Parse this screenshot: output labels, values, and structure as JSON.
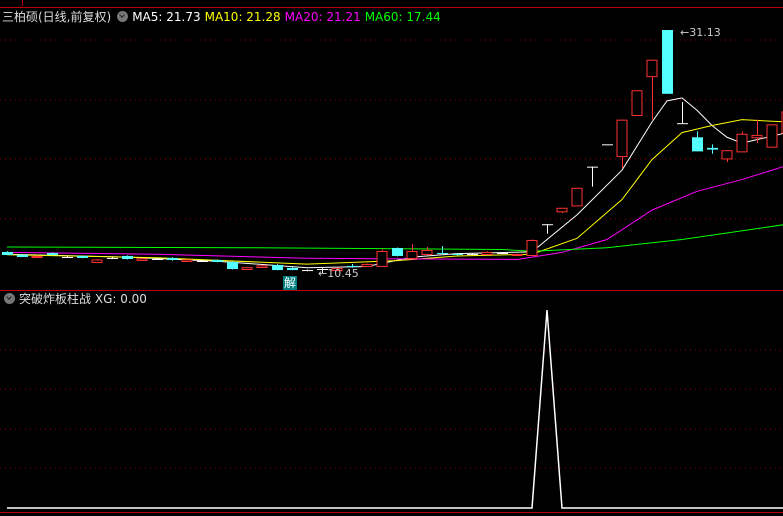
{
  "main": {
    "title": "三柏硕(日线,前复权)",
    "ma_labels": [
      {
        "label": "MA5: 21.73",
        "color": "#ffffff"
      },
      {
        "label": "MA10: 21.28",
        "color": "#ffff00"
      },
      {
        "label": "MA20: 21.21",
        "color": "#ff00ff"
      },
      {
        "label": "MA60: 17.44",
        "color": "#00ff00"
      }
    ],
    "high_label": "31.13",
    "low_label": "10.45",
    "marker_label": "解"
  },
  "sub": {
    "title": "突破炸板柱战",
    "xg_label": "XG: 0.00"
  },
  "colors": {
    "up": "#ff3232",
    "down": "#54ffff",
    "flat": "#ffffff",
    "grid": "#8b0000",
    "border": "#c00000"
  },
  "chart_data": [
    {
      "type": "candlestick",
      "ylim": [
        9.5,
        31.6
      ],
      "candles": [
        [
          12.24,
          12.3,
          12.0,
          11.98
        ],
        [
          12.0,
          12.05,
          11.8,
          11.81
        ],
        [
          11.81,
          11.95,
          11.75,
          11.9
        ],
        [
          12.15,
          12.2,
          11.95,
          11.98
        ],
        [
          11.81,
          11.9,
          11.75,
          11.81
        ],
        [
          11.9,
          11.95,
          11.7,
          11.73
        ],
        [
          11.39,
          11.64,
          11.35,
          11.6
        ],
        [
          11.73,
          11.8,
          11.65,
          11.73
        ],
        [
          11.9,
          11.95,
          11.6,
          11.64
        ],
        [
          11.56,
          11.73,
          11.5,
          11.7
        ],
        [
          11.64,
          11.7,
          11.6,
          11.64
        ],
        [
          11.73,
          11.78,
          11.5,
          11.56
        ],
        [
          11.47,
          11.64,
          11.45,
          11.6
        ],
        [
          11.47,
          11.55,
          11.4,
          11.47
        ],
        [
          11.56,
          11.6,
          11.35,
          11.39
        ],
        [
          11.39,
          11.45,
          10.75,
          10.79
        ],
        [
          10.79,
          10.96,
          10.75,
          10.94
        ],
        [
          10.96,
          11.13,
          10.9,
          11.1
        ],
        [
          11.13,
          11.2,
          10.68,
          10.7
        ],
        [
          10.88,
          10.95,
          10.68,
          10.7
        ],
        [
          10.7,
          10.75,
          10.6,
          10.7
        ],
        [
          10.79,
          10.85,
          10.45,
          10.79
        ],
        [
          10.7,
          10.9,
          10.65,
          10.88
        ],
        [
          11.05,
          11.22,
          10.9,
          10.96
        ],
        [
          11.05,
          11.25,
          11.0,
          11.22
        ],
        [
          11.05,
          12.45,
          11.0,
          12.32
        ],
        [
          12.58,
          12.62,
          11.85,
          11.9
        ],
        [
          11.73,
          12.92,
          11.7,
          12.32
        ],
        [
          12.07,
          12.66,
          12.0,
          12.41
        ],
        [
          12.15,
          12.75,
          12.05,
          12.07
        ],
        [
          12.07,
          12.15,
          11.95,
          11.98
        ],
        [
          12.07,
          12.1,
          12.0,
          12.07
        ],
        [
          12.07,
          12.3,
          12.0,
          12.24
        ],
        [
          12.15,
          12.2,
          12.1,
          12.15
        ],
        [
          11.98,
          12.1,
          11.95,
          12.07
        ],
        [
          11.98,
          13.3,
          11.98,
          13.26
        ],
        [
          14.6,
          14.6,
          13.8,
          14.6
        ],
        [
          15.7,
          16.0,
          15.55,
          16.0
        ],
        [
          16.2,
          17.7,
          16.2,
          17.7
        ],
        [
          19.5,
          19.5,
          17.8,
          19.5
        ],
        [
          21.4,
          21.4,
          21.4,
          21.4
        ],
        [
          20.4,
          23.5,
          19.4,
          23.5
        ],
        [
          23.9,
          26.0,
          23.9,
          26.0
        ],
        [
          27.2,
          28.6,
          23.5,
          28.6
        ],
        [
          31.13,
          31.13,
          25.7,
          25.7
        ],
        [
          23.2,
          25.0,
          23.2,
          23.2
        ],
        [
          22.0,
          22.5,
          20.8,
          20.8
        ],
        [
          21.1,
          21.4,
          20.6,
          20.95
        ],
        [
          20.2,
          20.9,
          19.9,
          20.9
        ],
        [
          20.8,
          22.5,
          20.8,
          22.3
        ],
        [
          22.0,
          23.5,
          21.5,
          22.2
        ],
        [
          21.2,
          23.1,
          21.2,
          23.1
        ],
        [
          22.4,
          24.2,
          22.4,
          24.2
        ]
      ],
      "ma_series": [
        {
          "name": "MA5",
          "color": "#ffffff",
          "points": [
            [
              0,
              12.05
            ],
            [
              8,
              11.8
            ],
            [
              14,
              11.45
            ],
            [
              20,
              10.9
            ],
            [
              24,
              11.0
            ],
            [
              27,
              11.8
            ],
            [
              30,
              12.1
            ],
            [
              35,
              12.25
            ],
            [
              38,
              15.4
            ],
            [
              41,
              19.2
            ],
            [
              43,
              23.3
            ],
            [
              44,
              25.1
            ],
            [
              45,
              25.35
            ],
            [
              46,
              24.3
            ],
            [
              47,
              23.0
            ],
            [
              48,
              22.0
            ],
            [
              49,
              21.5
            ],
            [
              50,
              21.8
            ],
            [
              52,
              22.4
            ]
          ]
        },
        {
          "name": "MA10",
          "color": "#ffff00",
          "points": [
            [
              0,
              12.0
            ],
            [
              10,
              11.75
            ],
            [
              20,
              11.2
            ],
            [
              26,
              11.5
            ],
            [
              30,
              11.9
            ],
            [
              35,
              12.05
            ],
            [
              38,
              13.4
            ],
            [
              41,
              16.7
            ],
            [
              43,
              20.1
            ],
            [
              45,
              22.4
            ],
            [
              47,
              23.0
            ],
            [
              49,
              23.5
            ],
            [
              52,
              23.3
            ]
          ]
        },
        {
          "name": "MA20",
          "color": "#ff00ff",
          "points": [
            [
              0,
              12.2
            ],
            [
              10,
              12.05
            ],
            [
              20,
              11.7
            ],
            [
              34,
              11.6
            ],
            [
              37,
              12.2
            ],
            [
              40,
              13.3
            ],
            [
              43,
              15.8
            ],
            [
              46,
              17.4
            ],
            [
              49,
              18.4
            ],
            [
              52,
              19.6
            ]
          ]
        },
        {
          "name": "MA60",
          "color": "#00ff00",
          "points": [
            [
              0,
              12.66
            ],
            [
              16,
              12.6
            ],
            [
              33,
              12.45
            ],
            [
              35,
              12.3
            ],
            [
              40,
              12.6
            ],
            [
              45,
              13.3
            ],
            [
              52,
              14.6
            ]
          ]
        }
      ]
    },
    {
      "type": "line",
      "series": [
        {
          "name": "XG",
          "color": "#ffffff",
          "values": [
            0,
            0,
            0,
            0,
            0,
            0,
            0,
            0,
            0,
            0,
            0,
            0,
            0,
            0,
            0,
            0,
            0,
            0,
            0,
            0,
            0,
            0,
            0,
            0,
            0,
            0,
            0,
            0,
            0,
            0,
            0,
            0,
            0,
            0,
            0,
            0,
            1,
            0,
            0,
            0,
            0,
            0,
            0,
            0,
            0,
            0,
            0,
            0,
            0,
            0,
            0,
            0,
            0
          ]
        }
      ],
      "ylim": [
        0,
        1
      ]
    }
  ]
}
